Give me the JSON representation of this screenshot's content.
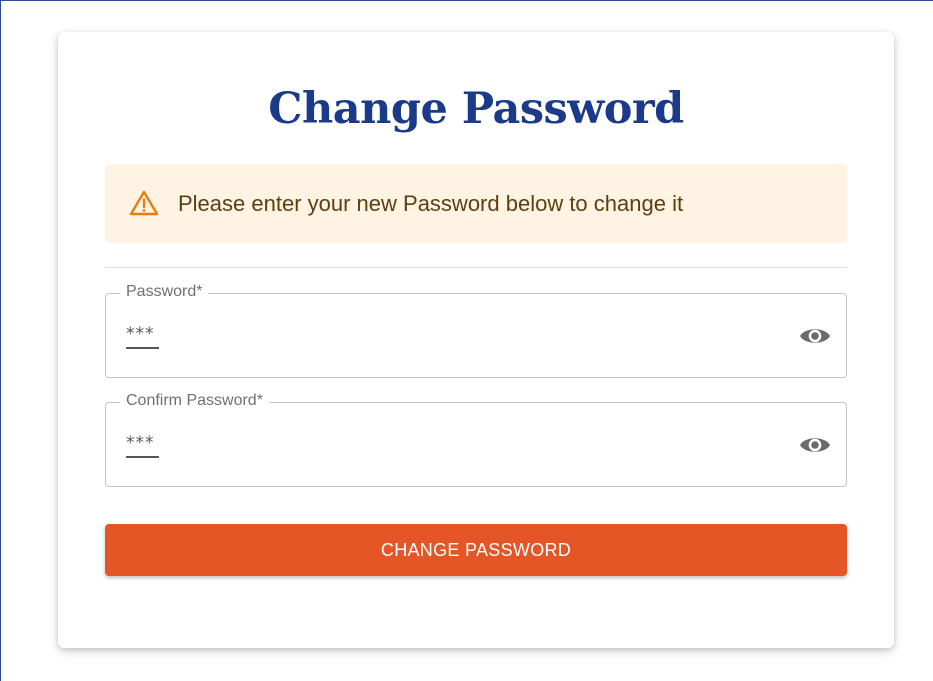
{
  "title": "Change Password",
  "alert": {
    "icon": "warning-triangle-icon",
    "text": "Please enter your new Password below to change it",
    "color": "#e77d12",
    "background": "#fff3e4"
  },
  "fields": [
    {
      "label": "Password*",
      "value": "***",
      "toggle_icon": "eye-icon"
    },
    {
      "label": "Confirm Password*",
      "value": "***",
      "toggle_icon": "eye-icon"
    }
  ],
  "submit": {
    "label": "CHANGE PASSWORD",
    "color": "#e45626"
  },
  "colors": {
    "title": "#1b3a8a"
  }
}
